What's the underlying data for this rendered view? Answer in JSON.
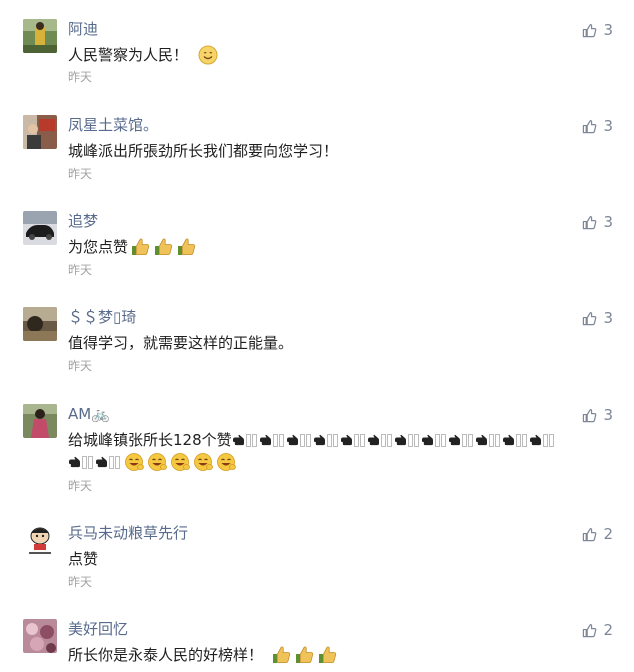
{
  "comments": [
    {
      "name": "阿迪",
      "text": "人民警察为人民！",
      "time": "昨天",
      "likes": "3",
      "avatar_icon": "person-outdoors-avatar",
      "emoji": [
        "smile-emoji"
      ]
    },
    {
      "name": "凤星土菜馆。",
      "text": "城峰派出所張劲所长我们都要向您学习！",
      "time": "昨天",
      "likes": "3",
      "avatar_icon": "restaurant-avatar"
    },
    {
      "name": "追梦",
      "text": "为您点赞",
      "time": "昨天",
      "likes": "3",
      "avatar_icon": "car-avatar",
      "emoji": [
        "thumbs-up-emoji",
        "thumbs-up-emoji",
        "thumbs-up-emoji"
      ]
    },
    {
      "name": "＄＄梦▯琦",
      "text": "值得学习，就需要这样的正能量。",
      "time": "昨天",
      "likes": "3",
      "avatar_icon": "landscape-avatar"
    },
    {
      "name": "AM🚲",
      "text": "给城峰镇张所长128个赞",
      "time": "昨天",
      "likes": "3",
      "avatar_icon": "woman-avatar",
      "line1_marks": 12,
      "line2_marks": 2,
      "emoji_line2": [
        "laughing-emoji",
        "laughing-emoji",
        "laughing-emoji",
        "laughing-emoji",
        "laughing-emoji"
      ]
    },
    {
      "name": "兵马未动粮草先行",
      "text": "点赞",
      "time": "昨天",
      "likes": "2",
      "avatar_icon": "cartoon-avatar"
    },
    {
      "name": "美好回忆",
      "text": "所长你是永泰人民的好榜样！",
      "time": "",
      "likes": "2",
      "avatar_icon": "flowers-avatar",
      "emoji": [
        "thumbs-up-emoji",
        "thumbs-up-emoji",
        "thumbs-up-emoji"
      ]
    }
  ],
  "colors": {
    "name": "#586b8c",
    "text": "#1f1f1f",
    "time": "#a3a3a3",
    "like": "#7d8798"
  }
}
